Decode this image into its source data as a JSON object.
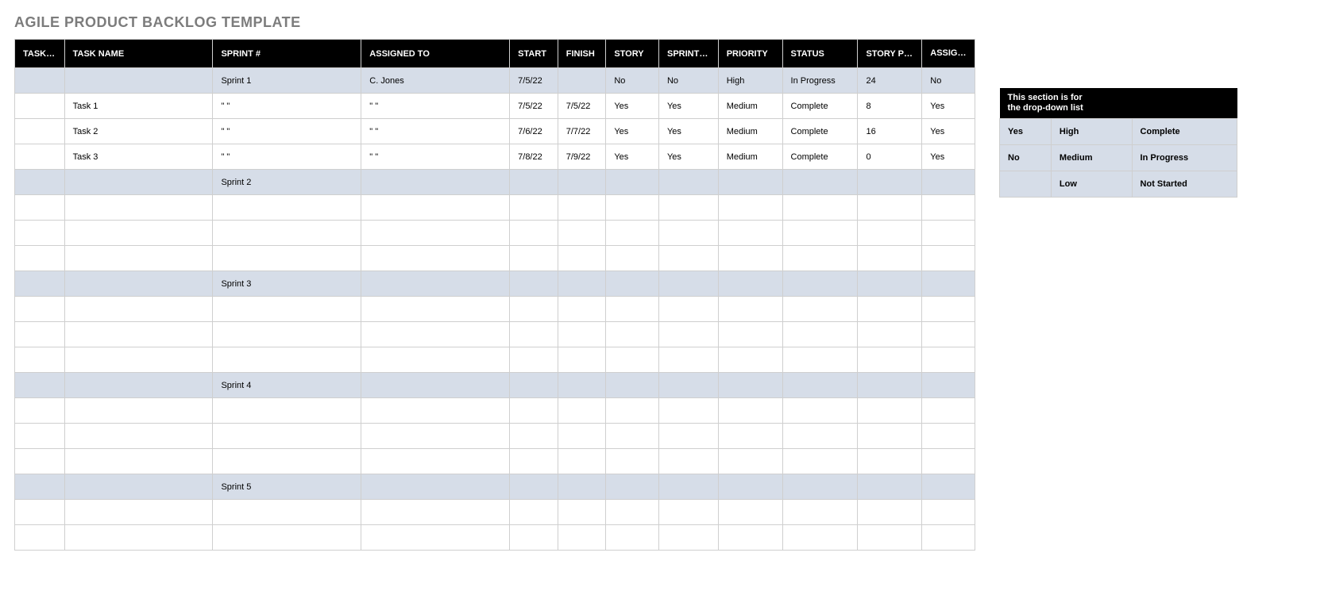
{
  "title": "AGILE PRODUCT BACKLOG TEMPLATE",
  "columns": {
    "task_id": "TASK ID",
    "task_name": "TASK NAME",
    "sprint": "SPRINT #",
    "assigned_to": "ASSIGNED TO",
    "start": "START",
    "finish": "FINISH",
    "story": "STORY",
    "sprint_ready": "SPRINT READY",
    "priority": "PRIORITY",
    "status": "STATUS",
    "story_points": "STORY POINTS",
    "assigned_to_sprint": "ASSIGNED TO SPRINT"
  },
  "rows": [
    {
      "type": "sprint",
      "task_id": "",
      "task_name": "",
      "sprint": "Sprint 1",
      "assigned_to": "C. Jones",
      "start": "7/5/22",
      "finish": "",
      "story": "No",
      "sprint_ready": "No",
      "priority": "High",
      "status": "In Progress",
      "story_points": "24",
      "assigned_to_sprint": "No"
    },
    {
      "type": "task",
      "task_id": "",
      "task_name": "Task 1",
      "sprint": "\" \"",
      "assigned_to": "\" \"",
      "start": "7/5/22",
      "finish": "7/5/22",
      "story": "Yes",
      "sprint_ready": "Yes",
      "priority": "Medium",
      "status": "Complete",
      "story_points": "8",
      "assigned_to_sprint": "Yes"
    },
    {
      "type": "task",
      "task_id": "",
      "task_name": "Task 2",
      "sprint": "\" \"",
      "assigned_to": "\" \"",
      "start": "7/6/22",
      "finish": "7/7/22",
      "story": "Yes",
      "sprint_ready": "Yes",
      "priority": "Medium",
      "status": "Complete",
      "story_points": "16",
      "assigned_to_sprint": "Yes"
    },
    {
      "type": "task",
      "task_id": "",
      "task_name": "Task 3",
      "sprint": "\" \"",
      "assigned_to": "\" \"",
      "start": "7/8/22",
      "finish": "7/9/22",
      "story": "Yes",
      "sprint_ready": "Yes",
      "priority": "Medium",
      "status": "Complete",
      "story_points": "0",
      "assigned_to_sprint": "Yes"
    },
    {
      "type": "sprint",
      "task_id": "",
      "task_name": "",
      "sprint": "Sprint 2",
      "assigned_to": "",
      "start": "",
      "finish": "",
      "story": "",
      "sprint_ready": "",
      "priority": "",
      "status": "",
      "story_points": "",
      "assigned_to_sprint": ""
    },
    {
      "type": "task",
      "task_id": "",
      "task_name": "",
      "sprint": "",
      "assigned_to": "",
      "start": "",
      "finish": "",
      "story": "",
      "sprint_ready": "",
      "priority": "",
      "status": "",
      "story_points": "",
      "assigned_to_sprint": ""
    },
    {
      "type": "task",
      "task_id": "",
      "task_name": "",
      "sprint": "",
      "assigned_to": "",
      "start": "",
      "finish": "",
      "story": "",
      "sprint_ready": "",
      "priority": "",
      "status": "",
      "story_points": "",
      "assigned_to_sprint": ""
    },
    {
      "type": "task",
      "task_id": "",
      "task_name": "",
      "sprint": "",
      "assigned_to": "",
      "start": "",
      "finish": "",
      "story": "",
      "sprint_ready": "",
      "priority": "",
      "status": "",
      "story_points": "",
      "assigned_to_sprint": ""
    },
    {
      "type": "sprint",
      "task_id": "",
      "task_name": "",
      "sprint": "Sprint 3",
      "assigned_to": "",
      "start": "",
      "finish": "",
      "story": "",
      "sprint_ready": "",
      "priority": "",
      "status": "",
      "story_points": "",
      "assigned_to_sprint": ""
    },
    {
      "type": "task",
      "task_id": "",
      "task_name": "",
      "sprint": "",
      "assigned_to": "",
      "start": "",
      "finish": "",
      "story": "",
      "sprint_ready": "",
      "priority": "",
      "status": "",
      "story_points": "",
      "assigned_to_sprint": ""
    },
    {
      "type": "task",
      "task_id": "",
      "task_name": "",
      "sprint": "",
      "assigned_to": "",
      "start": "",
      "finish": "",
      "story": "",
      "sprint_ready": "",
      "priority": "",
      "status": "",
      "story_points": "",
      "assigned_to_sprint": ""
    },
    {
      "type": "task",
      "task_id": "",
      "task_name": "",
      "sprint": "",
      "assigned_to": "",
      "start": "",
      "finish": "",
      "story": "",
      "sprint_ready": "",
      "priority": "",
      "status": "",
      "story_points": "",
      "assigned_to_sprint": ""
    },
    {
      "type": "sprint",
      "task_id": "",
      "task_name": "",
      "sprint": "Sprint 4",
      "assigned_to": "",
      "start": "",
      "finish": "",
      "story": "",
      "sprint_ready": "",
      "priority": "",
      "status": "",
      "story_points": "",
      "assigned_to_sprint": ""
    },
    {
      "type": "task",
      "task_id": "",
      "task_name": "",
      "sprint": "",
      "assigned_to": "",
      "start": "",
      "finish": "",
      "story": "",
      "sprint_ready": "",
      "priority": "",
      "status": "",
      "story_points": "",
      "assigned_to_sprint": ""
    },
    {
      "type": "task",
      "task_id": "",
      "task_name": "",
      "sprint": "",
      "assigned_to": "",
      "start": "",
      "finish": "",
      "story": "",
      "sprint_ready": "",
      "priority": "",
      "status": "",
      "story_points": "",
      "assigned_to_sprint": ""
    },
    {
      "type": "task",
      "task_id": "",
      "task_name": "",
      "sprint": "",
      "assigned_to": "",
      "start": "",
      "finish": "",
      "story": "",
      "sprint_ready": "",
      "priority": "",
      "status": "",
      "story_points": "",
      "assigned_to_sprint": ""
    },
    {
      "type": "sprint",
      "task_id": "",
      "task_name": "",
      "sprint": "Sprint 5",
      "assigned_to": "",
      "start": "",
      "finish": "",
      "story": "",
      "sprint_ready": "",
      "priority": "",
      "status": "",
      "story_points": "",
      "assigned_to_sprint": ""
    },
    {
      "type": "task",
      "task_id": "",
      "task_name": "",
      "sprint": "",
      "assigned_to": "",
      "start": "",
      "finish": "",
      "story": "",
      "sprint_ready": "",
      "priority": "",
      "status": "",
      "story_points": "",
      "assigned_to_sprint": ""
    },
    {
      "type": "task",
      "task_id": "",
      "task_name": "",
      "sprint": "",
      "assigned_to": "",
      "start": "",
      "finish": "",
      "story": "",
      "sprint_ready": "",
      "priority": "",
      "status": "",
      "story_points": "",
      "assigned_to_sprint": ""
    }
  ],
  "dropdown_ref": {
    "heading_line1": "This section is for",
    "heading_line2": "the drop-down list",
    "rows": [
      {
        "c1": "Yes",
        "c2": "High",
        "c3": "Complete"
      },
      {
        "c1": "No",
        "c2": "Medium",
        "c3": "In Progress"
      },
      {
        "c1": "",
        "c2": "Low",
        "c3": "Not Started"
      }
    ]
  }
}
